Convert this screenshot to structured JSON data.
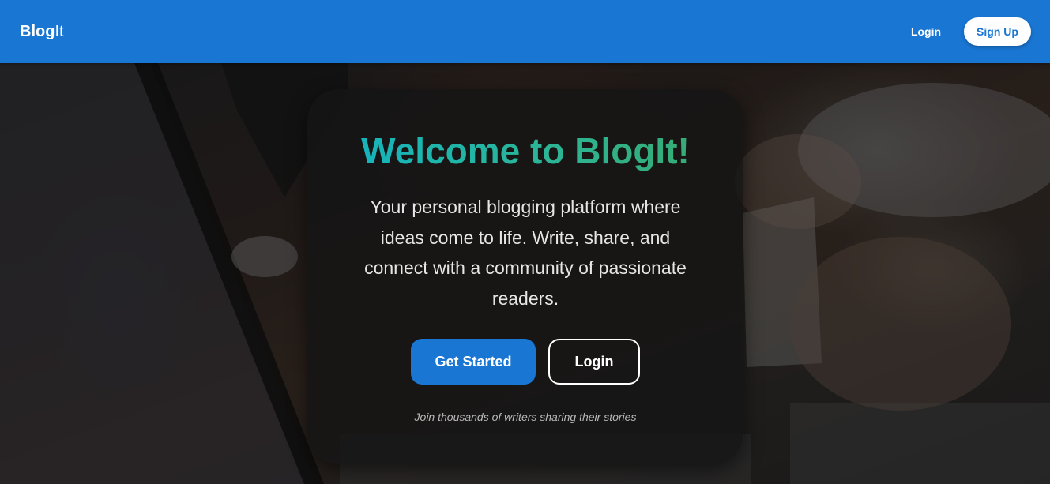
{
  "navbar": {
    "brand_strong": "Blog",
    "brand_light": "It",
    "login_label": "Login",
    "signup_label": "Sign Up"
  },
  "hero": {
    "background_icon": "office-desk-photo",
    "title": "Welcome to BlogIt!",
    "subtitle": "Your personal blogging platform where ideas come to life. Write, share, and connect with a community of passionate readers.",
    "primary_button_label": "Get Started",
    "secondary_button_label": "Login",
    "footnote": "Join thousands of writers sharing their stories"
  },
  "colors": {
    "brand_blue": "#1976d2",
    "title_gradient_start": "#0fb5c6",
    "title_gradient_end": "#3aa86a",
    "card_background": "#141414"
  }
}
